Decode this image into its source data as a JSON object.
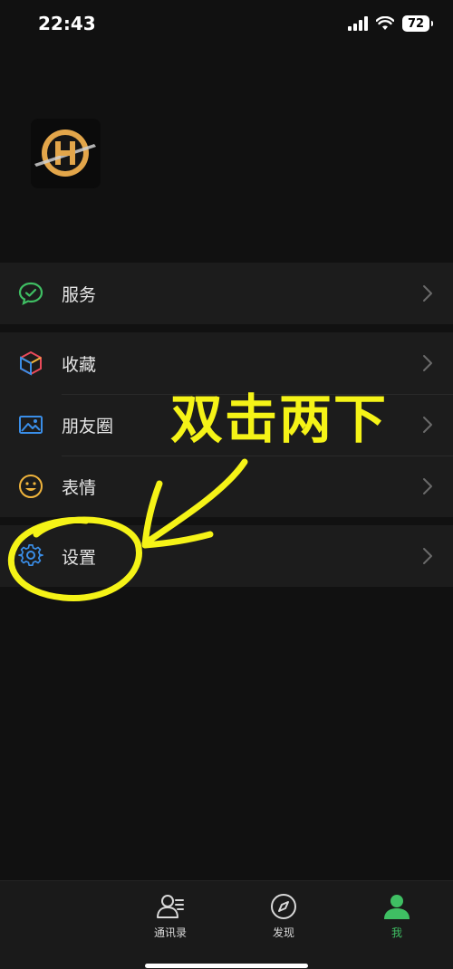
{
  "status": {
    "time": "22:43",
    "battery": "72"
  },
  "menu": {
    "services": "服务",
    "favorites": "收藏",
    "moments": "朋友圈",
    "stickers": "表情",
    "settings": "设置"
  },
  "annotation": {
    "text": "双击两下"
  },
  "tabbar": {
    "contacts": "通讯录",
    "discover": "发现",
    "me": "我"
  },
  "colors": {
    "accent_green": "#3fbf63",
    "annotation_yellow": "#f5f317",
    "background": "#111111",
    "row_background": "#1c1c1c"
  }
}
